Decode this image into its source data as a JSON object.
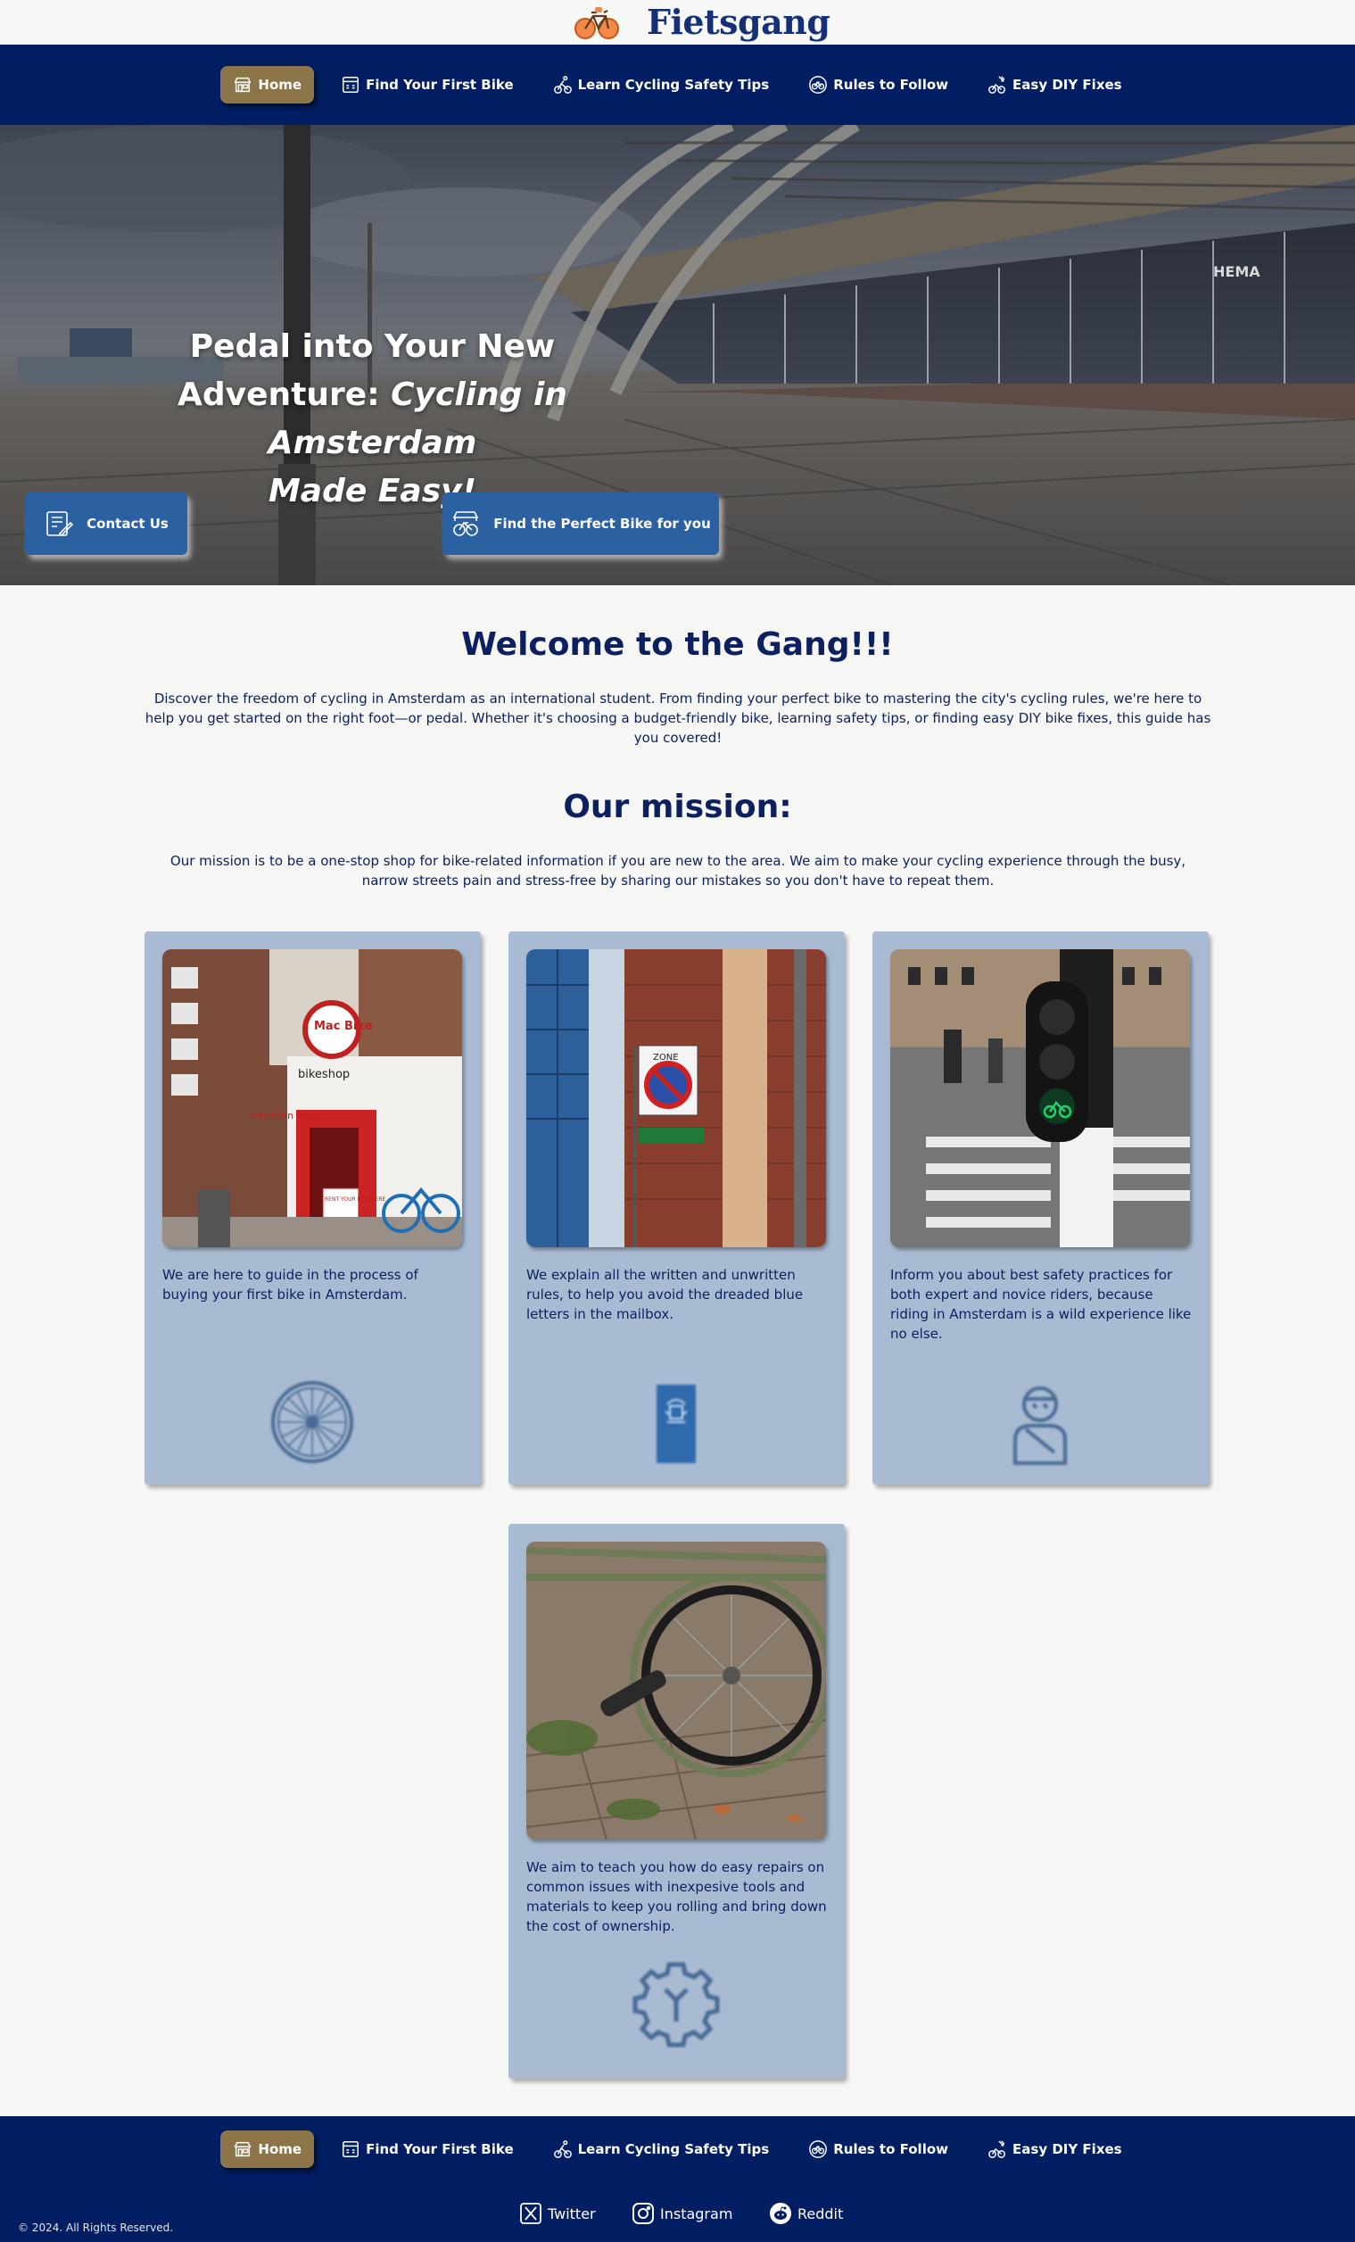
{
  "brand": {
    "name": "Fietsgang",
    "logo_icon": "bicycle-logo-icon"
  },
  "nav": [
    {
      "label": "Home",
      "icon": "storefront-icon",
      "active": true
    },
    {
      "label": "Find Your First Bike",
      "icon": "price-tag-icon",
      "active": false
    },
    {
      "label": "Learn Cycling Safety Tips",
      "icon": "cyclist-icon",
      "active": false
    },
    {
      "label": "Rules to Follow",
      "icon": "bike-badge-icon",
      "active": false
    },
    {
      "label": "Easy DIY Fixes",
      "icon": "bike-wrench-icon",
      "active": false
    }
  ],
  "hero": {
    "title_line1": "Pedal into Your New",
    "title_line2_plain": "Adventure: ",
    "title_line2_em": "Cycling in Amsterdam",
    "title_line3_em": "Made Easy!",
    "contact_button": "Contact Us",
    "find_bike_button": "Find the Perfect Bike for you",
    "sign_text": "HEMA"
  },
  "welcome": {
    "heading": "Welcome to the Gang!!!",
    "text": "Discover the freedom of cycling in Amsterdam as an international student. From finding your perfect bike to mastering the city's cycling rules, we're here to help you get started on the right foot—or pedal. Whether it's choosing a budget-friendly bike, learning safety tips, or finding easy DIY bike fixes, this guide has you covered!"
  },
  "mission": {
    "heading": "Our mission:",
    "text": "Our mission is to be a one-stop shop for bike-related information if you are new to the area. We aim to make your cycling experience through the busy, narrow streets pain and stress-free by sharing our mistakes so you don't have to repeat them."
  },
  "cards": [
    {
      "text": "We are here to guide in the process of buying your first bike in Amsterdam.",
      "icon": "bike-wheel-icon",
      "image": "bike-shop-photo",
      "shop_sign": "Mac Bike",
      "shop_banner": "bikeshop",
      "shop_tagline": "travel on bikes",
      "shop_board": "RENT YOUR BIKE HERE"
    },
    {
      "text": "We explain all the written and unwritten rules, to help you avoid the dreaded blue letters in the mailbox.",
      "icon": "government-letter-icon",
      "image": "no-parking-sign-photo",
      "sign_zone": "ZONE"
    },
    {
      "text": "Inform you about best safety practices for both expert and novice riders, because riding in Amsterdam is a wild experience like no else.",
      "icon": "injured-person-icon",
      "image": "bike-traffic-light-photo"
    },
    {
      "text": "We aim to teach you how do easy repairs on common issues with inexpesive tools and materials to keep you rolling and bring down the cost of ownership.",
      "icon": "gear-wrench-icon",
      "image": "bike-wheel-photo"
    }
  ],
  "footer": {
    "copyright": "© 2024. All Rights Reserved.",
    "social": [
      {
        "label": "Twitter",
        "icon": "x-twitter-icon"
      },
      {
        "label": "Instagram",
        "icon": "instagram-icon"
      },
      {
        "label": "Reddit",
        "icon": "reddit-icon"
      }
    ]
  },
  "colors": {
    "nav_bg": "#021e63",
    "nav_active": "#8c7548",
    "button_blue": "#2c61a1",
    "card_bg": "#a9bbd2",
    "heading_text": "#0c1f5e"
  }
}
